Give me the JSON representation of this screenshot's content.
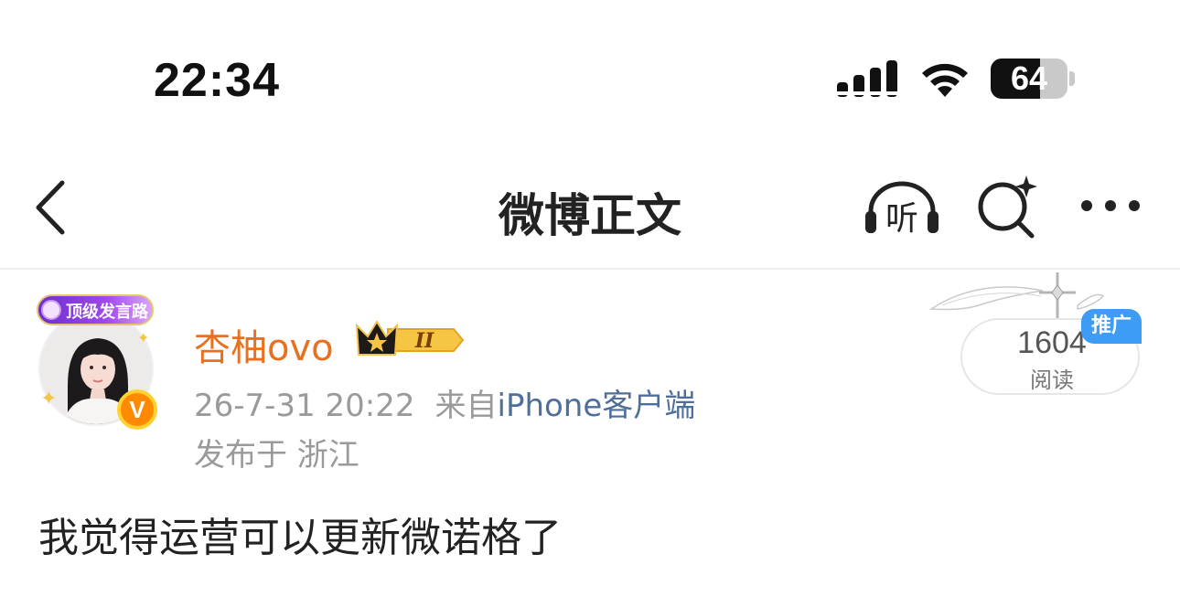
{
  "status_bar": {
    "time": "22:34",
    "battery": "64",
    "battery_level_percent": 64,
    "icons": [
      "signal-icon",
      "wifi-icon",
      "battery-icon"
    ]
  },
  "nav": {
    "title": "微博正文",
    "listen_label": "听",
    "icons": [
      "back-icon",
      "listen-icon",
      "search-icon",
      "more-icon"
    ]
  },
  "author": {
    "badge_label": "顶级发言路",
    "name": "杏柚ovo",
    "level": "II",
    "verified_mark": "V",
    "time": "26-7-31 20:22",
    "from_label": "来自",
    "source": "iPhone客户端",
    "location": "发布于 浙江"
  },
  "stats": {
    "reads": "1604",
    "reads_label": "阅读",
    "promo_label": "推广"
  },
  "post": {
    "text": "我觉得运营可以更新微诺格了"
  },
  "colors": {
    "username": "#e8701e",
    "source_link": "#4f6e9a",
    "promo": "#3d9cf5",
    "meta_text": "#9a9a9a"
  }
}
